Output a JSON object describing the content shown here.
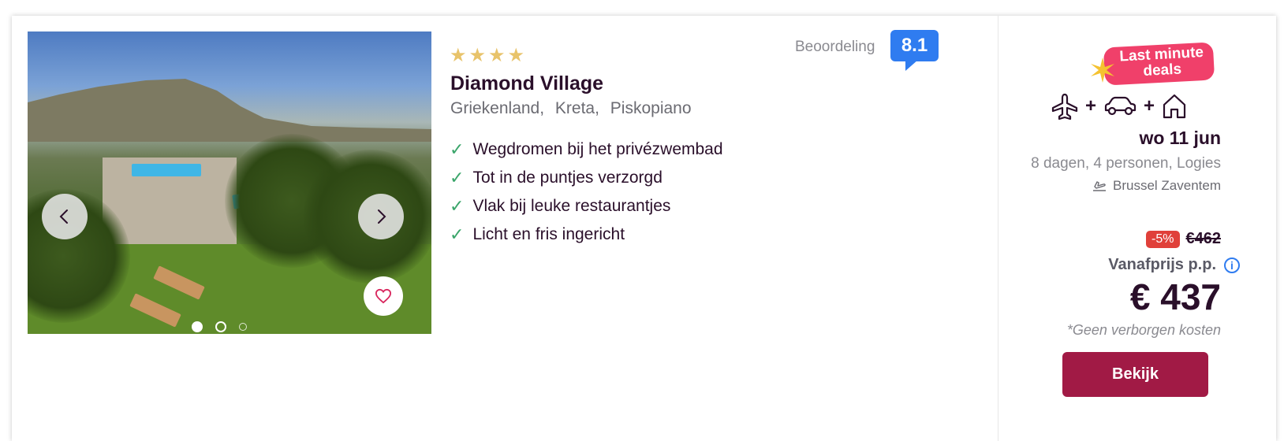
{
  "hotel": {
    "star_count": 4,
    "stars": [
      "★",
      "★",
      "★",
      "★"
    ],
    "name": "Diamond Village",
    "location": [
      "Griekenland,",
      "Kreta,",
      "Piskopiano"
    ]
  },
  "rating": {
    "label": "Beoordeling",
    "score": "8.1",
    "badge_color": "#2f7cf0"
  },
  "features": [
    "Wegdromen bij het privézwembad",
    "Tot in de puntjes verzorgd",
    "Vlak bij leuke restaurantjes",
    "Licht en fris ingericht"
  ],
  "gallery": {
    "slides_visible": 3,
    "active_index": 0
  },
  "deal": {
    "label_line1": "Last minute",
    "label_line2": "deals",
    "color": "#f0406a"
  },
  "trip": {
    "components": [
      "plane-icon",
      "car-icon",
      "house-icon"
    ],
    "plus": "+",
    "date": "wo 11 jun",
    "details": "8 dagen, 4 personen, Logies",
    "airport": "Brussel Zaventem"
  },
  "pricing": {
    "discount": "-5%",
    "old_price": "€462",
    "from_label": "Vanafprijs p.p.",
    "info_glyph": "i",
    "price": "€ 437",
    "note": "*Geen verborgen kosten",
    "cta_label": "Bekijk",
    "cta_color": "#a11a45"
  }
}
